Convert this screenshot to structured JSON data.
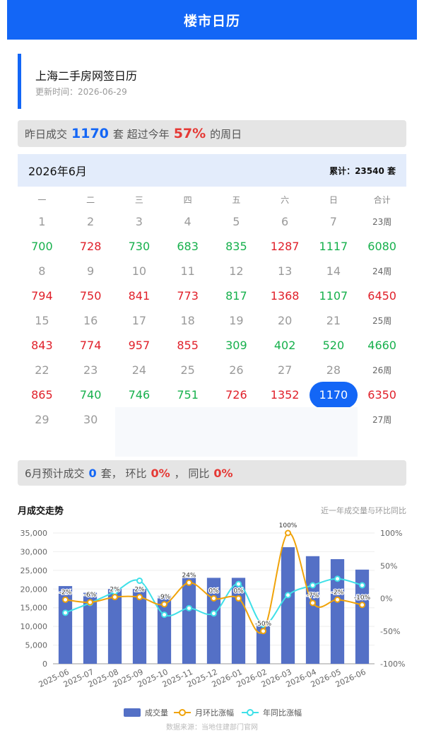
{
  "header": {
    "title": "楼市日历"
  },
  "info": {
    "title": "上海二手房网签日历",
    "updated": "更新时间：2026-06-29"
  },
  "banner1": {
    "prefix": "昨日成交",
    "count": "1170",
    "unit": "套 超过今年",
    "pct": "57%",
    "suffix": "的周日"
  },
  "calendar": {
    "month": "2026年6月",
    "total": "累计：23540 套",
    "weekdays": [
      "一",
      "二",
      "三",
      "四",
      "五",
      "六",
      "日",
      "合计"
    ],
    "weeks": [
      {
        "dates": [
          "1",
          "2",
          "3",
          "4",
          "5",
          "6",
          "7"
        ],
        "week": "23周",
        "values": [
          "700",
          "728",
          "730",
          "683",
          "835",
          "1287",
          "1117",
          "6080"
        ],
        "trend": [
          "down",
          "up",
          "down",
          "down",
          "down",
          "up",
          "down",
          "down"
        ]
      },
      {
        "dates": [
          "8",
          "9",
          "10",
          "11",
          "12",
          "13",
          "14"
        ],
        "week": "24周",
        "values": [
          "794",
          "750",
          "841",
          "773",
          "817",
          "1368",
          "1107",
          "6450"
        ],
        "trend": [
          "up",
          "up",
          "up",
          "up",
          "down",
          "up",
          "down",
          "up"
        ]
      },
      {
        "dates": [
          "15",
          "16",
          "17",
          "18",
          "19",
          "20",
          "21"
        ],
        "week": "25周",
        "values": [
          "843",
          "774",
          "957",
          "855",
          "309",
          "402",
          "520",
          "4660"
        ],
        "trend": [
          "up",
          "up",
          "up",
          "up",
          "down",
          "down",
          "down",
          "down"
        ]
      },
      {
        "dates": [
          "22",
          "23",
          "24",
          "25",
          "26",
          "27",
          "28"
        ],
        "week": "26周",
        "values": [
          "865",
          "740",
          "746",
          "751",
          "726",
          "1352",
          "1170",
          "6350"
        ],
        "trend": [
          "up",
          "down",
          "down",
          "down",
          "up",
          "up",
          "selected",
          "up"
        ]
      },
      {
        "dates": [
          "29",
          "30"
        ],
        "week": "27周"
      }
    ]
  },
  "banner2": {
    "prefix": "6月预计成交",
    "count": "0",
    "mid": "套， 环比",
    "mom": "0%",
    "sep": "，  同比",
    "yoy": "0%"
  },
  "chart_header": {
    "title": "月成交走势",
    "subtitle": "近一年成交量与环比同比"
  },
  "chart_data": {
    "type": "bar",
    "categories": [
      "2025-06",
      "2025-07",
      "2025-08",
      "2025-09",
      "2025-10",
      "2025-11",
      "2025-12",
      "2026-01",
      "2026-02",
      "2026-03",
      "2026-04",
      "2026-05",
      "2026-06"
    ],
    "series": [
      {
        "name": "成交量",
        "type": "bar",
        "axis": "left",
        "values": [
          20800,
          19000,
          20000,
          20000,
          18200,
          23000,
          23000,
          23000,
          10600,
          31200,
          28800,
          28000,
          25200
        ]
      },
      {
        "name": "月环比涨幅",
        "type": "line",
        "axis": "right",
        "values": [
          -2,
          -6,
          2,
          2,
          -9,
          24,
          0,
          0,
          -50,
          100,
          -7,
          -2,
          -10
        ],
        "labels": [
          "-2%",
          "-6%",
          "2%",
          "2%",
          "-9%",
          "24%",
          "0%",
          "0%",
          "-50%",
          "100%",
          "-7%",
          "-2%",
          "-10%"
        ]
      },
      {
        "name": "年同比涨幅",
        "type": "line",
        "axis": "right",
        "values": [
          -22,
          -7,
          10,
          27,
          -25,
          -15,
          -23,
          22,
          -40,
          5,
          20,
          30,
          20
        ]
      }
    ],
    "left_axis": {
      "ticks": [
        "0",
        "5,000",
        "10,000",
        "15,000",
        "20,000",
        "25,000",
        "30,000",
        "35,000"
      ],
      "ylim": [
        0,
        35000
      ]
    },
    "right_axis": {
      "ticks": [
        "-100%",
        "-50%",
        "0%",
        "50%",
        "100%"
      ],
      "ylim": [
        -100,
        100
      ]
    },
    "colors": {
      "bar": "#5470c6",
      "mom": "#f0a30a",
      "yoy": "#3fe0e8"
    },
    "legend_position": "bottom"
  },
  "footer": {
    "source": "数据来源：当地住建部门官网"
  }
}
